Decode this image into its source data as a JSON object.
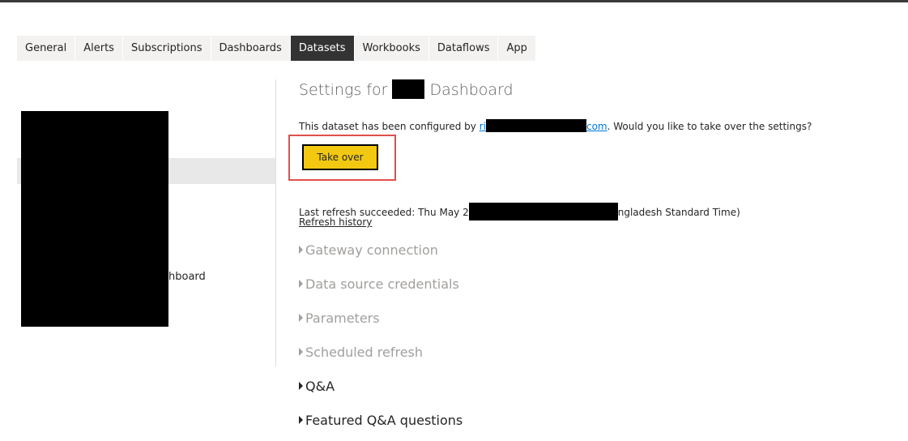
{
  "tabs": [
    "General",
    "Alerts",
    "Subscriptions",
    "Dashboards",
    "Datasets",
    "Workbooks",
    "Dataflows",
    "App"
  ],
  "active_tab": "Datasets",
  "sidebar": {
    "visible_text": "hboard"
  },
  "main": {
    "title_prefix": "Settings for",
    "title_suffix": "Dashboard",
    "configured_prefix": "This dataset has been configured by ",
    "email_start": "ri",
    "email_end": "com",
    "configured_suffix": ". Would you like to take over the settings?",
    "take_over_label": "Take over",
    "refresh_prefix": "Last refresh succeeded: Thu May 2",
    "refresh_suffix": "ngladesh Standard Time)",
    "refresh_history": "Refresh history",
    "sections": [
      "Gateway connection",
      "Data source credentials",
      "Parameters",
      "Scheduled refresh",
      "Q&A",
      "Featured Q&A questions"
    ]
  },
  "colors": {
    "accent": "#f2c811",
    "highlight": "#e0504a",
    "link": "#0078d4"
  }
}
